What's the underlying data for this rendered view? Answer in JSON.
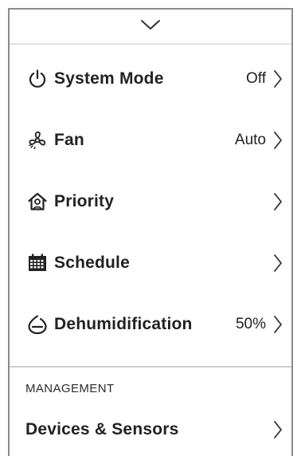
{
  "menu": {
    "items": [
      {
        "label": "System Mode",
        "value": "Off",
        "icon": "power-icon"
      },
      {
        "label": "Fan",
        "value": "Auto",
        "icon": "fan-icon"
      },
      {
        "label": "Priority",
        "value": "",
        "icon": "home-priority-icon"
      },
      {
        "label": "Schedule",
        "value": "",
        "icon": "calendar-icon"
      },
      {
        "label": "Dehumidification",
        "value": "50%",
        "icon": "humidity-icon"
      }
    ]
  },
  "management": {
    "header": "MANAGEMENT",
    "items": [
      {
        "label": "Devices & Sensors",
        "icon": ""
      }
    ]
  },
  "colors": {
    "text": "#222222",
    "divider": "#cfcfcf",
    "border": "#8a8a8a"
  }
}
